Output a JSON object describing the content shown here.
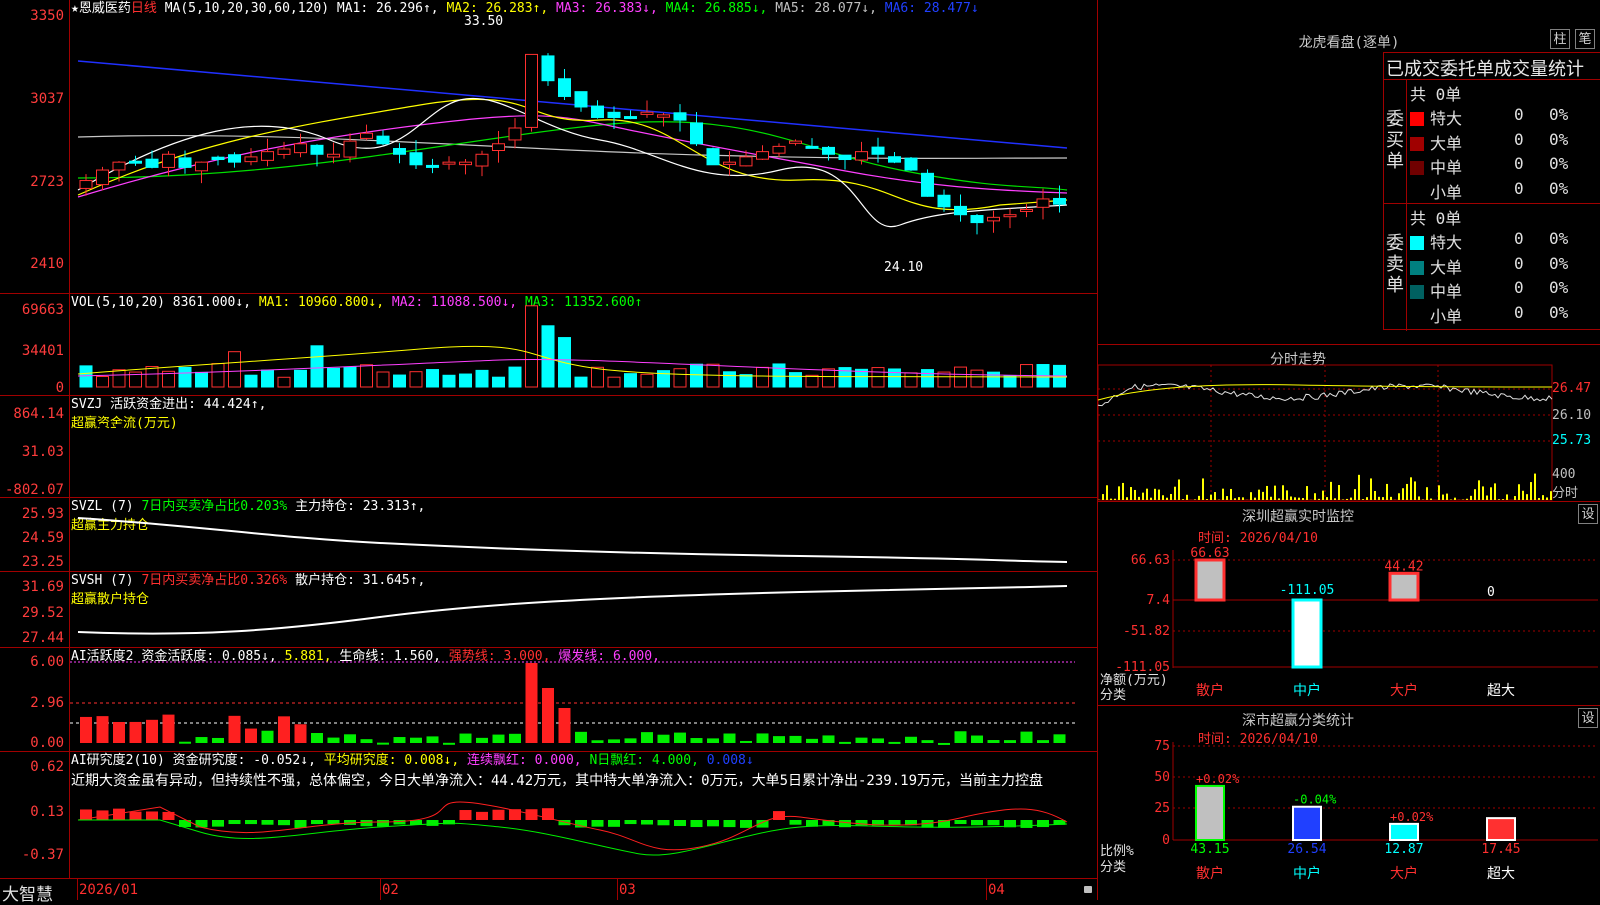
{
  "stock": {
    "name": "恩威医药",
    "period": "日线",
    "star": "★"
  },
  "main_chart": {
    "ma_label": "MA(5,10,20,30,60,120)",
    "ma": [
      {
        "text": "MA1: 26.296↑,",
        "color": "#ffffff"
      },
      {
        "text": "MA2: 26.283↑,",
        "color": "#ffff00"
      },
      {
        "text": "MA3: 26.383↓,",
        "color": "#ff40ff"
      },
      {
        "text": "MA4: 26.885↓,",
        "color": "#00ff00"
      },
      {
        "text": "MA5: 28.077↓,",
        "color": "#c0c0c0"
      },
      {
        "text": "MA6: 28.477↓",
        "color": "#2040ff"
      }
    ],
    "y_ticks": [
      "3350",
      "3037",
      "2723",
      "2410"
    ],
    "high_label": "33.50",
    "low_label": "24.10"
  },
  "vol": {
    "title": "VOL(5,10,20)",
    "items": [
      {
        "text": "8361.000↓,",
        "color": "#ffffff"
      },
      {
        "text": "MA1: 10960.800↓,",
        "color": "#ffff00"
      },
      {
        "text": "MA2: 11088.500↓,",
        "color": "#ff40ff"
      },
      {
        "text": "MA3: 11352.600↑",
        "color": "#00ff00"
      }
    ],
    "y_ticks": [
      "69663",
      "34401",
      "0"
    ]
  },
  "svzj": {
    "title": "SVZJ",
    "items": [
      {
        "text": "活跃资金进出: 44.424↑,",
        "color": "#ffffff"
      }
    ],
    "sub": "超赢资金流(万元)",
    "y_ticks": [
      "864.14",
      "31.03",
      "-802.07"
    ]
  },
  "svzl": {
    "title": "SVZL (7)",
    "items": [
      {
        "text": "7日内买卖净占比0.203%",
        "color": "#00ff00"
      },
      {
        "text": "主力持仓: 23.313↑,",
        "color": "#ffffff"
      }
    ],
    "sub": "超赢主力持仓",
    "y_ticks": [
      "25.93",
      "24.59",
      "23.25"
    ]
  },
  "svsh": {
    "title": "SVSH (7)",
    "items": [
      {
        "text": "7日内买卖净占比0.326%",
        "color": "#ff3030"
      },
      {
        "text": "散户持仓: 31.645↑,",
        "color": "#ffffff"
      }
    ],
    "sub": "超赢散户持仓",
    "y_ticks": [
      "31.69",
      "29.52",
      "27.44"
    ]
  },
  "ai1": {
    "title": "AI活跃度2",
    "items": [
      {
        "text": "资金活跃度: 0.085↓,",
        "color": "#ffffff"
      },
      {
        "text": "5.881,",
        "color": "#ffff00"
      },
      {
        "text": "生命线: 1.560,",
        "color": "#ffffff"
      },
      {
        "text": "强势线: 3.000,",
        "color": "#ff3030"
      },
      {
        "text": "爆发线: 6.000,",
        "color": "#ff40ff"
      }
    ],
    "y_ticks": [
      "6.00",
      "2.96",
      "0.00"
    ]
  },
  "ai2": {
    "title": "AI研究度2(10)",
    "items": [
      {
        "text": "资金研究度: -0.052↓,",
        "color": "#ffffff"
      },
      {
        "text": "平均研究度: 0.008↓,",
        "color": "#ffff00"
      },
      {
        "text": "连续飘红: 0.000,",
        "color": "#ff40ff"
      },
      {
        "text": "N日飘红: 4.000,",
        "color": "#00ff00"
      },
      {
        "text": "0.008↓",
        "color": "#2040ff"
      }
    ],
    "comment": "近期大资金虽有异动，但持续性不强，总体偏空，今日大单净流入：44.42万元，其中特大单净流入：0万元，大单5日累计净出-239.19万元，当前主力控盘",
    "y_ticks": [
      "0.62",
      "0.13",
      "-0.37"
    ]
  },
  "x_axis": {
    "labels": [
      "2026/01",
      "02",
      "03",
      "04"
    ],
    "brand": "大智慧"
  },
  "longhu": {
    "title": "龙虎看盘(逐单)",
    "btn1": "柱",
    "btn2": "笔",
    "header": "已成交委托单成交量统计",
    "buy_label": "委买单",
    "sell_label": "委卖单",
    "buy_total": "共 0单",
    "sell_total": "共 0单",
    "buy_rows": [
      {
        "name": "特大",
        "val": "0",
        "pct": "0%",
        "color": "#ff0000"
      },
      {
        "name": "大单",
        "val": "0",
        "pct": "0%",
        "color": "#a00000"
      },
      {
        "name": "中单",
        "val": "0",
        "pct": "0%",
        "color": "#700000"
      },
      {
        "name": "小单",
        "val": "0",
        "pct": "0%",
        "color": ""
      }
    ],
    "sell_rows": [
      {
        "name": "特大",
        "val": "0",
        "pct": "0%",
        "color": "#00ffff"
      },
      {
        "name": "大单",
        "val": "0",
        "pct": "0%",
        "color": "#008080"
      },
      {
        "name": "中单",
        "val": "0",
        "pct": "0%",
        "color": "#006060"
      },
      {
        "name": "小单",
        "val": "0",
        "pct": "0%",
        "color": ""
      }
    ]
  },
  "fenshi": {
    "title": "分时走势",
    "labels": [
      "26.47",
      "26.10",
      "25.73",
      "400",
      "分时"
    ]
  },
  "monitor": {
    "title": "深圳超赢实时监控",
    "btn": "设",
    "time": "时间: 2026/04/10",
    "y_ticks": [
      "66.63",
      "7.4",
      "-51.82",
      "-111.05"
    ],
    "y_label1": "净额(万元)",
    "y_label2": "分类",
    "bars": [
      {
        "cat": "散户",
        "value": 66.63,
        "label": "66.63"
      },
      {
        "cat": "中户",
        "value": -111.05,
        "label": "-111.05"
      },
      {
        "cat": "大户",
        "value": 44.42,
        "label": "44.42"
      },
      {
        "cat": "超大",
        "value": 0,
        "label": "0"
      }
    ]
  },
  "classify": {
    "title": "深市超赢分类统计",
    "btn": "设",
    "time": "时间: 2026/04/10",
    "y_ticks": [
      "75",
      "50",
      "25",
      "0"
    ],
    "y_label1": "比例%",
    "y_label2": "分类",
    "bars": [
      {
        "cat": "散户",
        "value": 43.15,
        "label": "43.15",
        "change": "+0.02%"
      },
      {
        "cat": "中户",
        "value": 26.54,
        "label": "26.54",
        "change": "-0.04%"
      },
      {
        "cat": "大户",
        "value": 12.87,
        "label": "12.87",
        "change": "+0.02%"
      },
      {
        "cat": "超大",
        "value": 17.45,
        "label": "17.45",
        "change": ""
      }
    ]
  }
}
